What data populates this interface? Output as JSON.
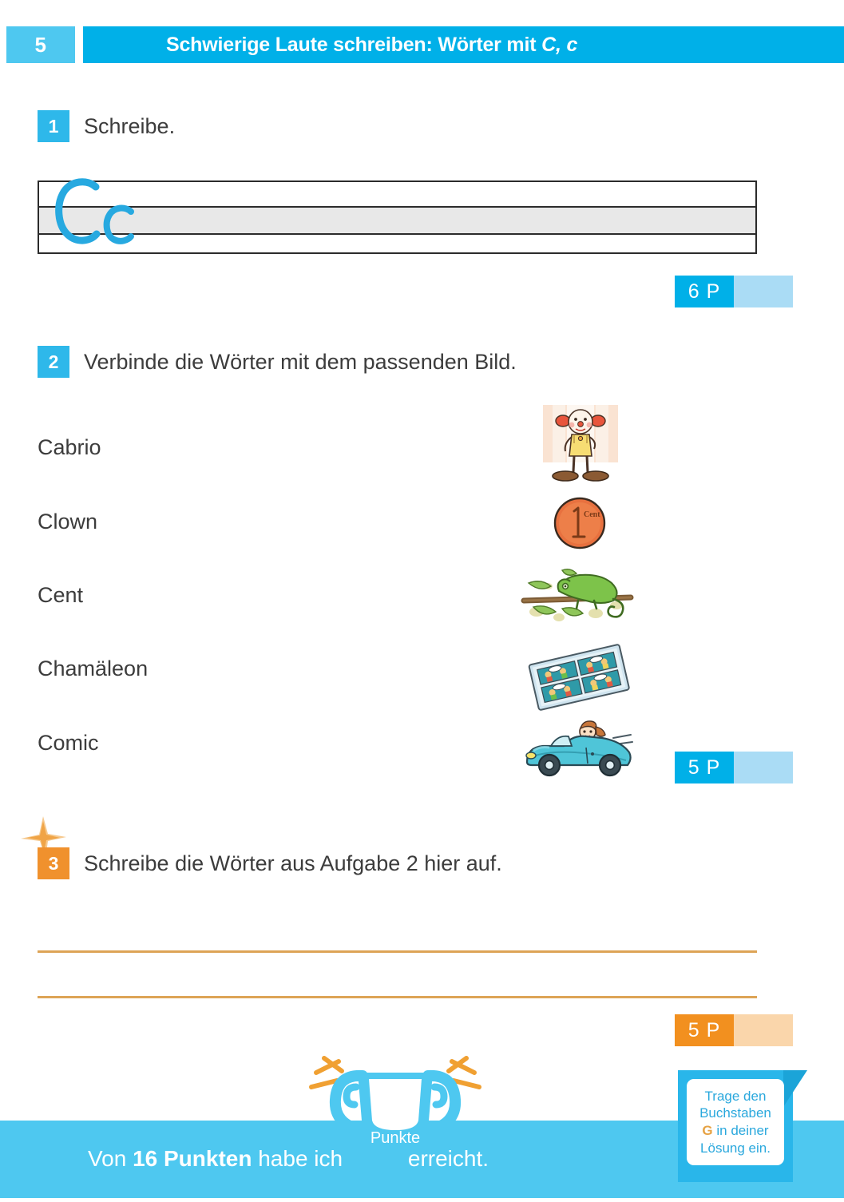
{
  "header": {
    "page_number": "5",
    "title_prefix": "Schwierige Laute schreiben: Wörter mit ",
    "title_letters": "C, c",
    "full_title": "Schwierige Laute schreiben: Wörter mit C, c"
  },
  "tasks": [
    {
      "number": "1",
      "instruction": "Schreibe.",
      "badge_color": "#2eb8ea",
      "trace_letters": "Cc",
      "trace_letter_color": "#27a9e0",
      "points": {
        "value": "6 P",
        "color": "#00b0e8",
        "blank_color": "#aadcf5"
      }
    },
    {
      "number": "2",
      "instruction": "Verbinde die Wörter mit dem passenden Bild.",
      "badge_color": "#2eb8ea",
      "words": [
        "Cabrio",
        "Clown",
        "Cent",
        "Chamäleon",
        "Comic"
      ],
      "pictures": [
        {
          "name": "clown-picture",
          "label": "Clown"
        },
        {
          "name": "cent-coin-picture",
          "label": "Cent",
          "coin_text": "1 Cent"
        },
        {
          "name": "chameleon-picture",
          "label": "Chamäleon"
        },
        {
          "name": "comic-book-picture",
          "label": "Comic"
        },
        {
          "name": "cabrio-car-picture",
          "label": "Cabrio"
        }
      ],
      "points": {
        "value": "5 P",
        "color": "#00b0e8",
        "blank_color": "#aadcf5"
      }
    },
    {
      "number": "3",
      "instruction": "Schreibe die Wörter aus Aufgabe 2 hier auf.",
      "badge_color": "#f0912d",
      "answer_line_count": 2,
      "points": {
        "value": "5 P",
        "color": "#f2901f",
        "blank_color": "#fad6ab"
      }
    }
  ],
  "footer": {
    "text_before": "Von ",
    "total_points": "16 Punkten",
    "text_middle": " habe ich ",
    "text_after": "erreicht.",
    "trophy_label": "Punkte",
    "band_color": "#4ec8f0"
  },
  "hint_note": {
    "line1": "Trage den",
    "line2": "Buchstaben",
    "letter": "G",
    "line3": " in deiner",
    "line4": "Lösung ein.",
    "box_color": "#29b6ea",
    "text_color": "#2aa8dd",
    "letter_color": "#e6a243"
  }
}
